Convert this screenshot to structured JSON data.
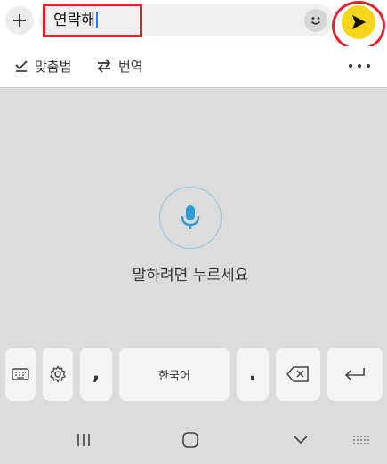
{
  "compose": {
    "message_text": "연락해",
    "plus_icon": "plus-icon",
    "emoji_icon": "emoji-icon",
    "send_icon": "send-icon",
    "send_color": "#f7d51b",
    "highlight_color": "#e8212d"
  },
  "toolbar": {
    "spellcheck_label": "맞춤법",
    "translate_label": "번역",
    "more_icon": "more-icon"
  },
  "voice": {
    "prompt": "말하려면 누르세요",
    "mic_icon": "microphone-icon",
    "accent_color": "#2c9bd6"
  },
  "keyboard": {
    "comma": ",",
    "language_label": "한국어",
    "period": ".",
    "keys_icons": [
      "keyboard-icon",
      "settings-gear-icon",
      "backspace-icon",
      "enter-icon"
    ]
  },
  "navbar": {
    "icons": [
      "recent-apps-icon",
      "home-icon",
      "back-icon",
      "keyboard-switch-icon"
    ]
  }
}
